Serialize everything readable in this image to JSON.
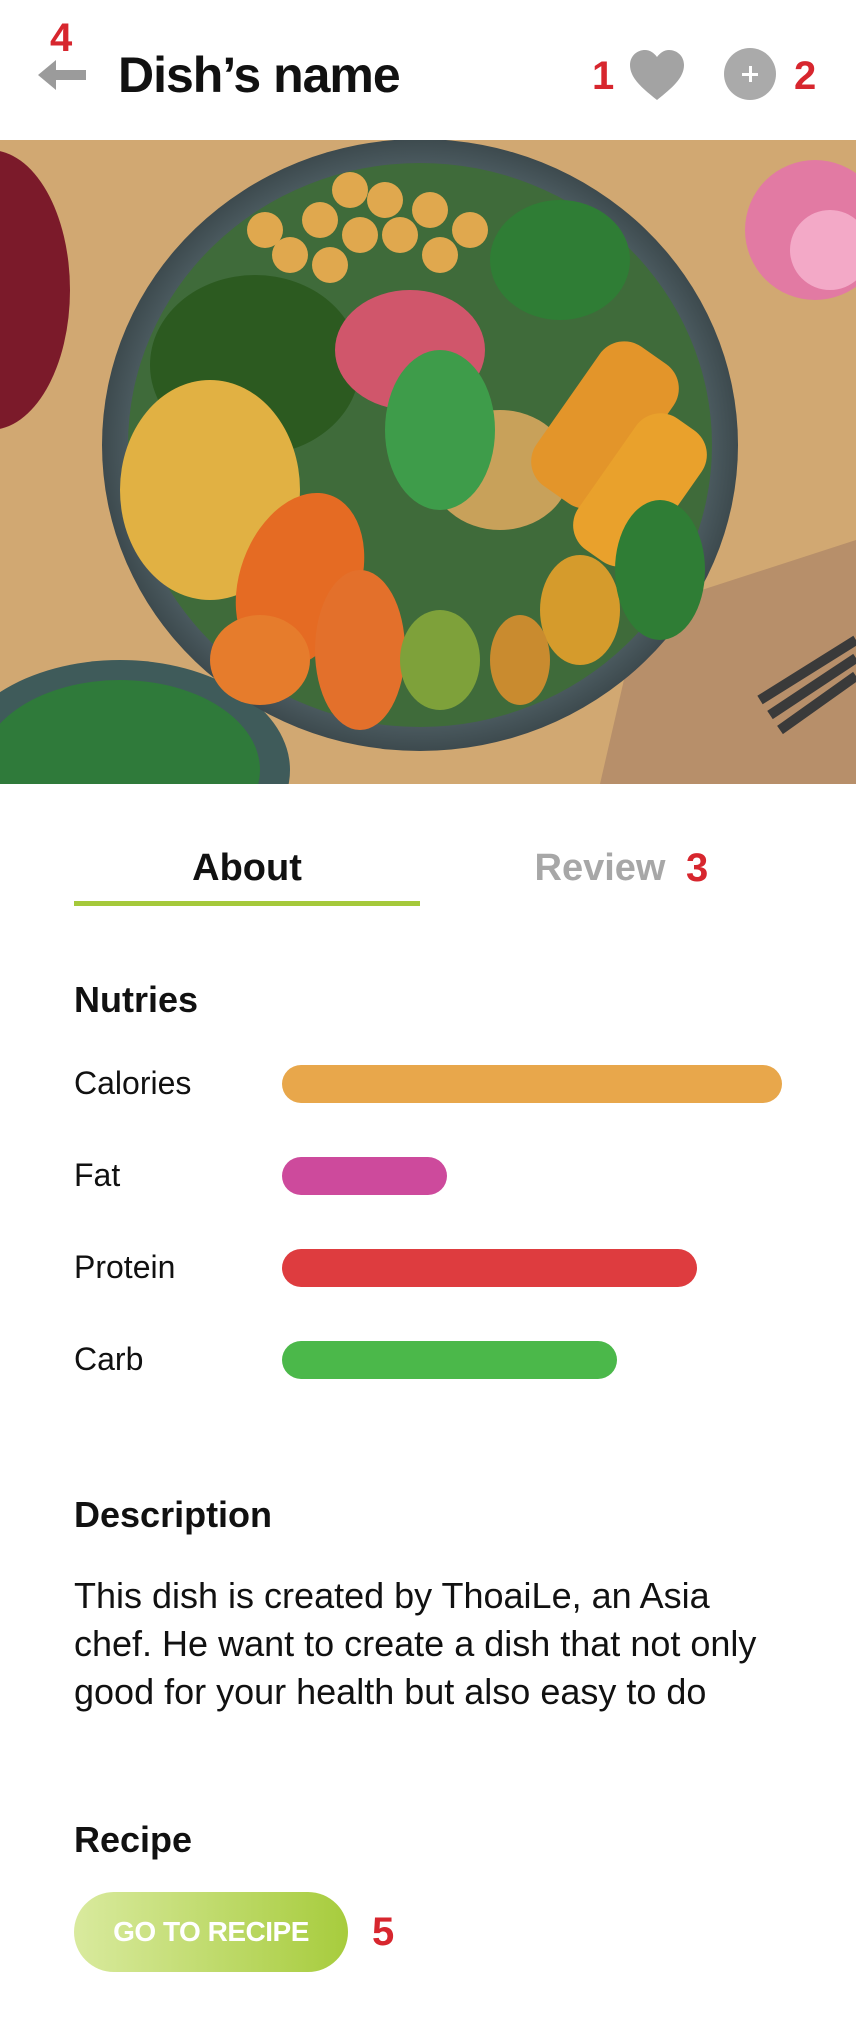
{
  "header": {
    "title": "Dish’s name"
  },
  "annotations": {
    "like": "1",
    "add": "2",
    "review": "3",
    "back": "4",
    "recipe_button": "5"
  },
  "tabs": [
    {
      "label": "About",
      "active": true
    },
    {
      "label": "Review",
      "active": false
    }
  ],
  "nutrition": {
    "title": "Nutries",
    "items": [
      {
        "label": "Calories",
        "level": 1.0,
        "color": "#e8a74b"
      },
      {
        "label": "Fat",
        "level": 0.33,
        "color": "#cd4a9c"
      },
      {
        "label": "Protein",
        "level": 0.83,
        "color": "#de3c3f"
      },
      {
        "label": "Carb",
        "level": 0.67,
        "color": "#4bb84a"
      }
    ]
  },
  "description": {
    "title": "Description",
    "text": "This dish is created by ThoaiLe, an Asia chef. He want to create a dish that not only good for your health but also easy to do"
  },
  "recipe": {
    "title": "Recipe",
    "button_label": "GO TO RECIPE"
  },
  "colors": {
    "accent": "#a5c93b",
    "annotation": "#d7262e",
    "inactive_tab": "#a7a7a7"
  },
  "icons": {
    "back": "arrow-left-icon",
    "like": "heart-icon",
    "add": "plus-circle-icon"
  }
}
